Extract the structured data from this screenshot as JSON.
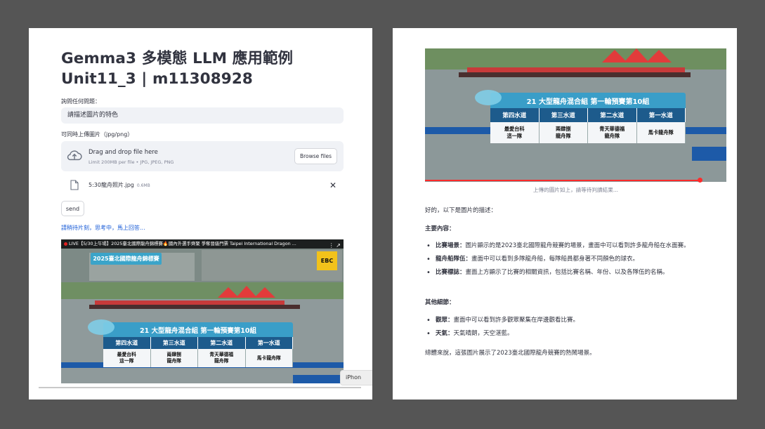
{
  "left": {
    "title_line1": "Gemma3 多模態 LLM 應用範例",
    "title_line2": "Unit11_3 | m11308928",
    "question_label": "詢問任何問題：",
    "question_value": "請描述圖片的特色",
    "upload_label": "可同時上傳圖片（jpg/png）",
    "dropzone_main": "Drag and drop file here",
    "dropzone_sub": "Limit 200MB per file • JPG, JPEG, PNG",
    "browse_label": "Browse files",
    "file_name": "5:30龍舟照片.jpg",
    "file_size": "0.6MB",
    "remove_symbol": "✕",
    "send_label": "send",
    "thinking_text": "請稍待片刻，思考中，馬上回答...",
    "iphone_tag": "iPhon",
    "video": {
      "topbar_text": "LIVE【5/30上午場】2025臺北國際龍舟錦標賽🔥國內外選手齊聚 爭奪晉級門票 Taipei International Dragon ...",
      "banner_text": "2025臺北國際龍舟錦標賽",
      "logo_text": "EBC"
    }
  },
  "overlay": {
    "title": "21 大型龍舟混合組 第一輪預賽第10組",
    "lanes": [
      "第四水道",
      "第三水道",
      "第二水道",
      "第一水道"
    ],
    "teams": [
      "最愛台科\n這一隊",
      "兩肆捌\n龍舟隊",
      "青天華德福\n龍舟隊",
      "馬卡龍舟隊"
    ]
  },
  "right": {
    "caption": "上傳的圖片如上，請等待判讀結果...",
    "intro": "好的，以下是圖片的描述：",
    "main_heading": "主要內容：",
    "main_items": [
      {
        "label": "比賽場景：",
        "text": "圖片顯示的是2023臺北國際龍舟競賽的場景，畫面中可以看到許多龍舟船在水面賽。"
      },
      {
        "label": "龍舟船隊伍：",
        "text": "畫面中可以看到多隊龍舟船，每隊船員都身著不同顏色的球衣。"
      },
      {
        "label": "比賽標誌：",
        "text": "畫面上方顯示了比賽的相關資訊，包括比賽名稱、年份、以及各隊伍的名稱。"
      }
    ],
    "other_heading": "其他細節：",
    "other_items": [
      {
        "label": "觀眾：",
        "text": "畫面中可以看到許多觀眾聚集在岸邊觀看比賽。"
      },
      {
        "label": "天氣：",
        "text": "天氣晴朗，天空湛藍。"
      }
    ],
    "summary": "總體來說，這張圖片展示了2023臺北國際龍舟競賽的熱鬧場景。"
  },
  "colors": {
    "background": "#555555",
    "link_blue": "#1a5cd7",
    "input_bg": "#f0f2f6",
    "progress_red": "#ff2b2b"
  }
}
